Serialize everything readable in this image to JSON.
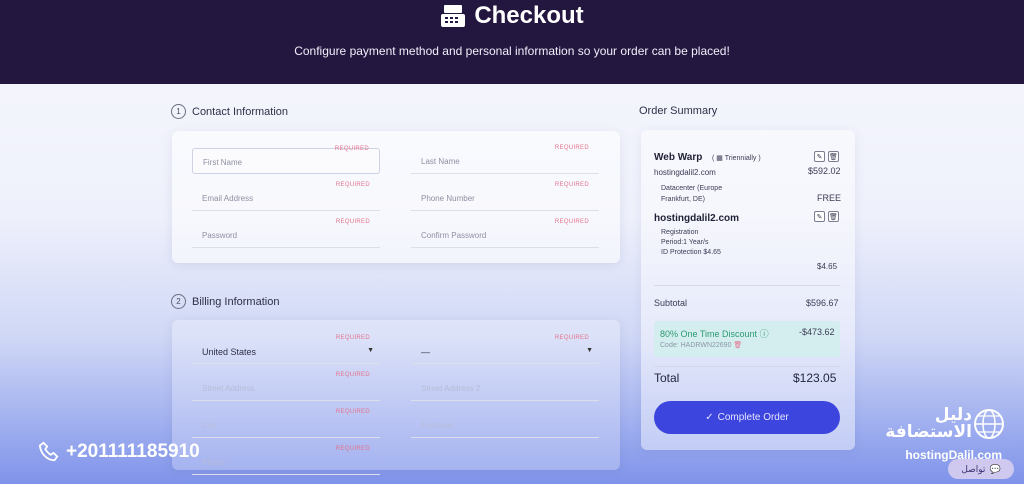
{
  "header": {
    "title": "Checkout",
    "subtitle": "Configure payment method and personal information so your order can be placed!"
  },
  "contact": {
    "step": "1",
    "title": "Contact Information",
    "required_label": "REQUIRED",
    "fields": {
      "first_name": "First Name",
      "last_name": "Last Name",
      "email": "Email Address",
      "phone": "Phone Number",
      "password": "Password",
      "confirm_password": "Confirm Password"
    }
  },
  "billing": {
    "step": "2",
    "title": "Billing Information",
    "country": "United States",
    "state": "—",
    "street": "Street Address",
    "street2": "Street Address 2",
    "city": "City",
    "postcode": "Postcode",
    "bottom_field": "Phone"
  },
  "summary": {
    "title": "Order Summary",
    "item1": {
      "name": "Web Warp",
      "cycle": "Triennially",
      "domain": "hostingdalil2.com",
      "price": "$592.02",
      "detail_line1": "Datacenter (Europe",
      "detail_line2": "Frankfurt, DE)",
      "detail_price": "FREE"
    },
    "item2": {
      "name": "hostingdalil2.com",
      "line1": "Registration",
      "line2": "Period:1 Year/s",
      "line3": "ID Protection $4.65",
      "price": "$4.65"
    },
    "subtotal_label": "Subtotal",
    "subtotal": "$596.67",
    "discount_label": "80% One Time Discount",
    "discount": "-$473.62",
    "discount_code": "Code: HADRWN22690",
    "total_label": "Total",
    "total": "$123.05",
    "complete_label": "Complete Order"
  },
  "overlay": {
    "phone": "+201111185910",
    "watermark_ar_line1": "دليل",
    "watermark_ar_line2": "الاستضافة",
    "watermark_url": "hostingDalil.com",
    "chat_label": "تواصل"
  }
}
